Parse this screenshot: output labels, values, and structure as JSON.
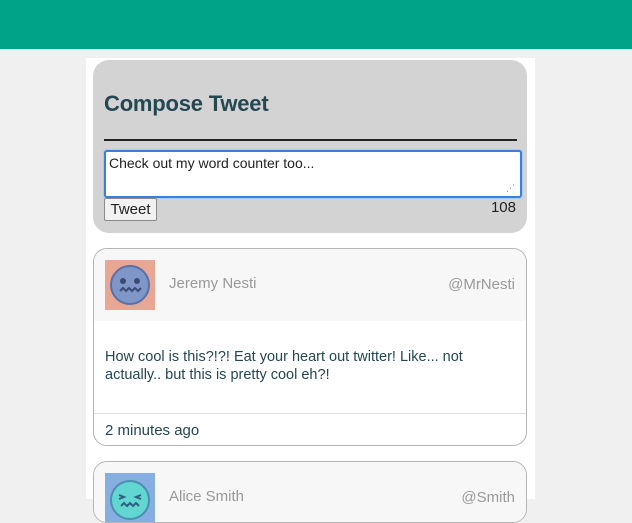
{
  "compose": {
    "title": "Compose Tweet",
    "input_value": "Check out my word counter too...",
    "button_label": "Tweet",
    "char_count": "108"
  },
  "tweets": [
    {
      "name": "Jeremy Nesti",
      "handle": "@MrNesti",
      "text": "How cool is this?!?! Eat your heart out twitter! Like... not actually.. but this is pretty cool eh?!",
      "time": "2 minutes ago",
      "avatar_bg": "#e8a695",
      "avatar_fg": "#7f96c9"
    },
    {
      "name": "Alice Smith",
      "handle": "@Smith",
      "avatar_bg": "#86aee0",
      "avatar_fg": "#62d6d0"
    }
  ],
  "colors": {
    "topbar": "#00a388",
    "heading": "#244751"
  }
}
